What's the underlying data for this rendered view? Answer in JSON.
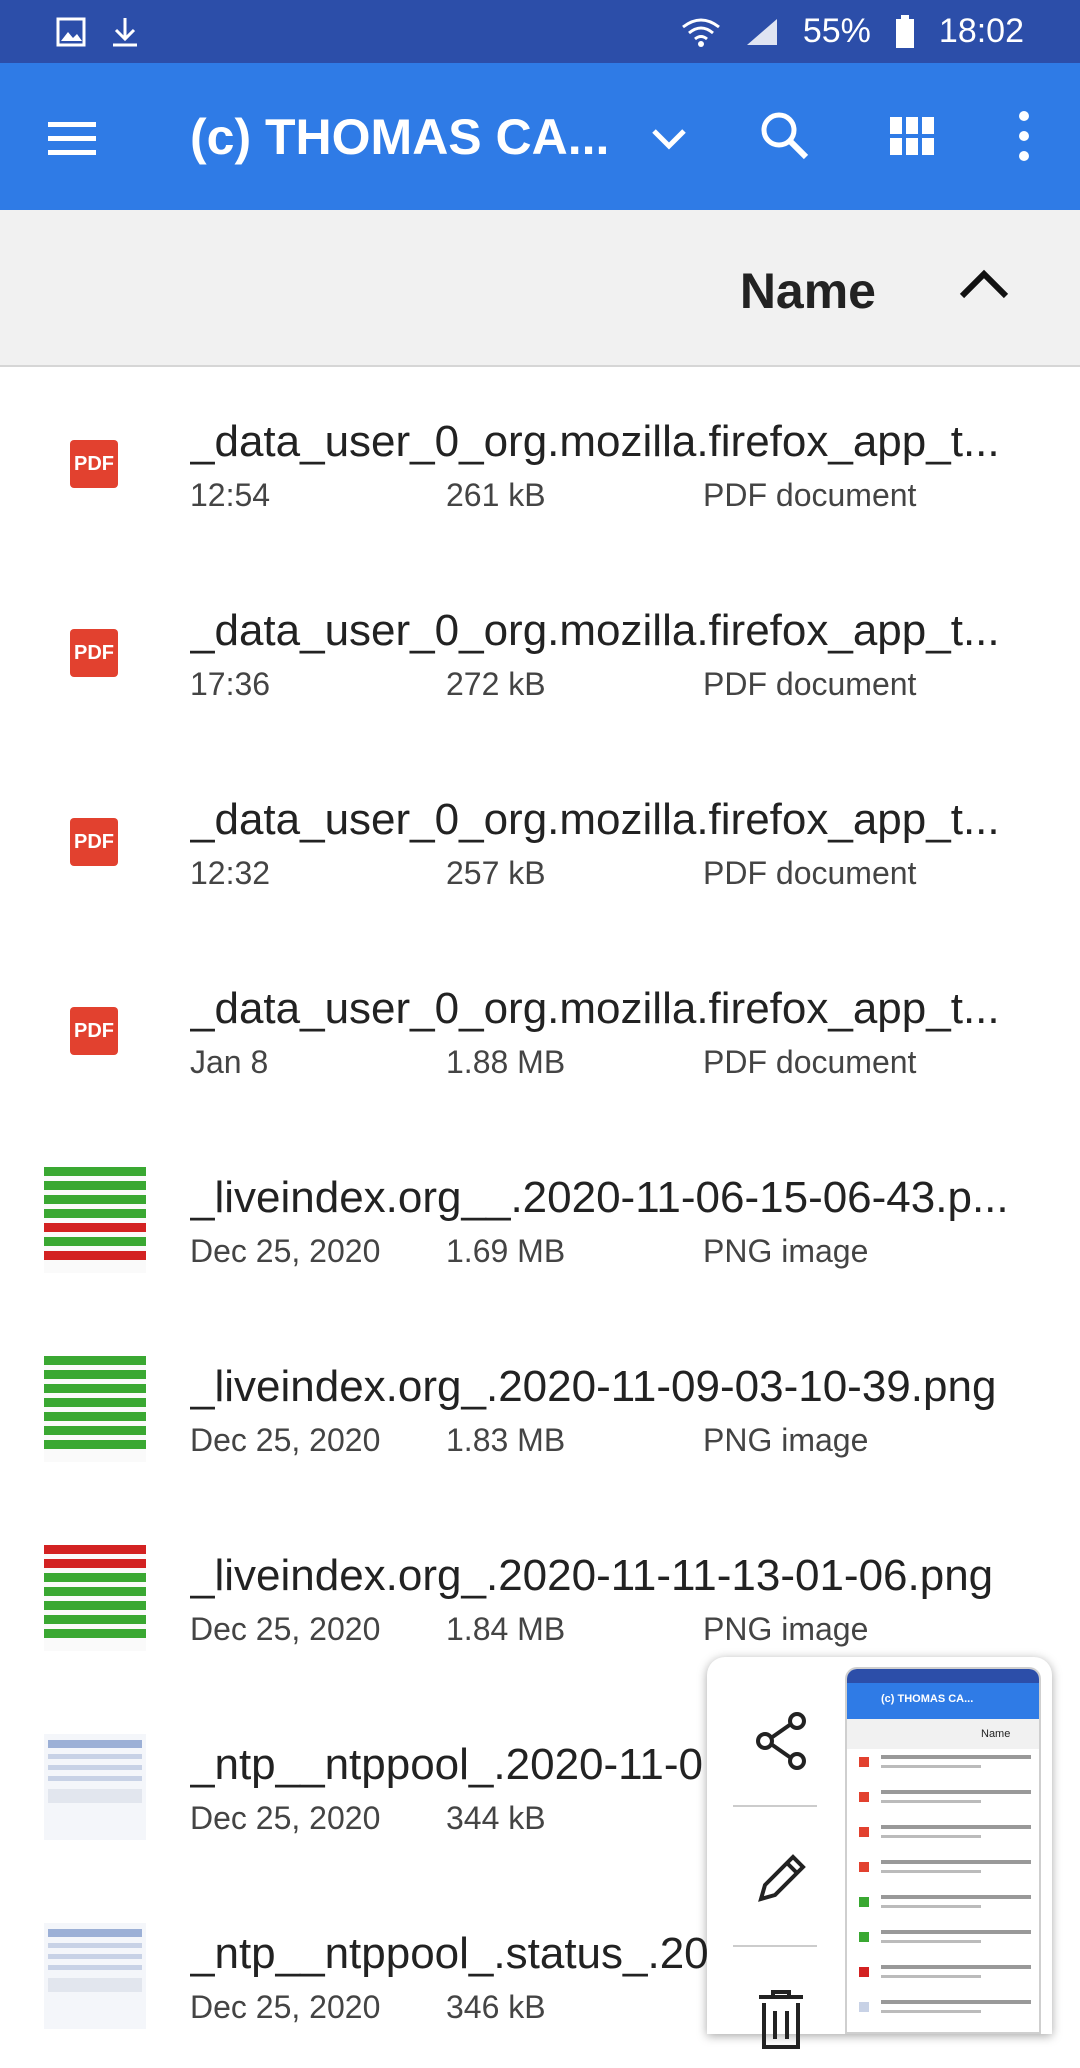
{
  "status_bar": {
    "left_icons": [
      "image-icon",
      "download-icon"
    ],
    "wifi_icon": "wifi-icon",
    "signal_icon": "signal-icon",
    "battery_percent": "55%",
    "battery_icon": "battery-icon",
    "time": "18:02"
  },
  "app_bar": {
    "title": "(c) THOMAS CA...",
    "menu_icon": "menu-icon",
    "chevron_icon": "chevron-down-icon",
    "search_icon": "search-icon",
    "grid_icon": "grid-view-icon",
    "more_icon": "more-vert-icon",
    "color": "#2f7be6"
  },
  "sort_bar": {
    "label": "Name",
    "direction_icon": "chevron-up-icon"
  },
  "files": [
    {
      "name": "_data_user_0_org.mozilla.firefox_app_t...",
      "date": "12:54",
      "size": "261 kB",
      "type": "PDF document",
      "icon": "pdf"
    },
    {
      "name": "_data_user_0_org.mozilla.firefox_app_t...",
      "date": "17:36",
      "size": "272 kB",
      "type": "PDF document",
      "icon": "pdf"
    },
    {
      "name": "_data_user_0_org.mozilla.firefox_app_t...",
      "date": "12:32",
      "size": "257 kB",
      "type": "PDF document",
      "icon": "pdf"
    },
    {
      "name": "_data_user_0_org.mozilla.firefox_app_t...",
      "date": "Jan 8",
      "size": "1.88 MB",
      "type": "PDF document",
      "icon": "pdf"
    },
    {
      "name": "_liveindex.org__.2020-11-06-15-06-43.p...",
      "date": "Dec 25, 2020",
      "size": "1.69 MB",
      "type": "PNG image",
      "icon": "green-table"
    },
    {
      "name": "_liveindex.org_.2020-11-09-03-10-39.png",
      "date": "Dec 25, 2020",
      "size": "1.83 MB",
      "type": "PNG image",
      "icon": "green-table"
    },
    {
      "name": "_liveindex.org_.2020-11-11-13-01-06.png",
      "date": "Dec 25, 2020",
      "size": "1.84 MB",
      "type": "PNG image",
      "icon": "red-green-table"
    },
    {
      "name": "_ntp__ntppool_.2020-11-0",
      "date": "Dec 25, 2020",
      "size": "344 kB",
      "type": "",
      "icon": "web"
    },
    {
      "name": "_ntp__ntppool_.status_.20",
      "date": "Dec 25, 2020",
      "size": "346 kB",
      "type": "",
      "icon": "web"
    }
  ],
  "popup": {
    "share_icon": "share-icon",
    "edit_icon": "edit-icon",
    "delete_icon": "trash-icon",
    "preview_title": "(c) THOMAS CA...",
    "preview_sort_label": "Name"
  },
  "pdf_label": "PDF"
}
